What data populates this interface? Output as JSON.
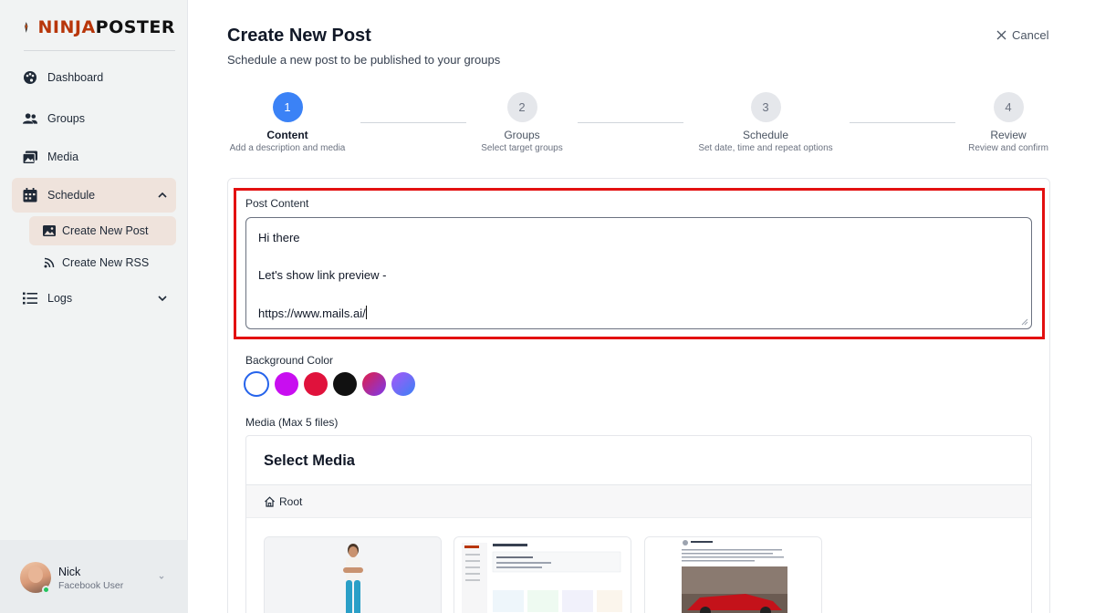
{
  "brand": {
    "name_part1": "NINJA",
    "name_part2": "POSTER"
  },
  "sidebar": {
    "items": [
      {
        "label": "Dashboard",
        "icon": "palette-icon"
      },
      {
        "label": "Groups",
        "icon": "users-icon"
      },
      {
        "label": "Media",
        "icon": "images-icon"
      },
      {
        "label": "Schedule",
        "icon": "calendar-icon",
        "expanded": true
      },
      {
        "label": "Logs",
        "icon": "list-icon",
        "expanded": false
      }
    ],
    "schedule_children": [
      {
        "label": "Create New Post",
        "icon": "image-icon"
      },
      {
        "label": "Create New RSS",
        "icon": "rss-icon"
      }
    ]
  },
  "user": {
    "name": "Nick",
    "role": "Facebook User",
    "status": "online"
  },
  "header": {
    "title": "Create New Post",
    "subtitle": "Schedule a new post to be published to your groups",
    "cancel_label": "Cancel"
  },
  "steps": [
    {
      "number": "1",
      "title": "Content",
      "description": "Add a description and media",
      "active": true
    },
    {
      "number": "2",
      "title": "Groups",
      "description": "Select target groups",
      "active": false
    },
    {
      "number": "3",
      "title": "Schedule",
      "description": "Set date, time and repeat options",
      "active": false
    },
    {
      "number": "4",
      "title": "Review",
      "description": "Review and confirm",
      "active": false
    }
  ],
  "form": {
    "post_content_label": "Post Content",
    "post_content_lines": [
      "Hi there",
      "",
      "Let's show link preview -",
      "",
      "https://www.mails.ai/"
    ],
    "background_color_label": "Background Color",
    "colors": [
      "#ffffff",
      "#c80ef0",
      "#e0123c",
      "#111111",
      "linear-gradient(135deg,#e11d48,#7c3aed)",
      "linear-gradient(135deg,#a855f7,#3b82f6)"
    ],
    "media_label": "Media (Max 5 files)"
  },
  "media_browser": {
    "title": "Select Media",
    "breadcrumb_root": "Root"
  },
  "colors": {
    "accent": "#3b82f6",
    "brand": "#b8360a",
    "active_nav_bg": "#efe3dc",
    "highlight": "#e31010"
  }
}
